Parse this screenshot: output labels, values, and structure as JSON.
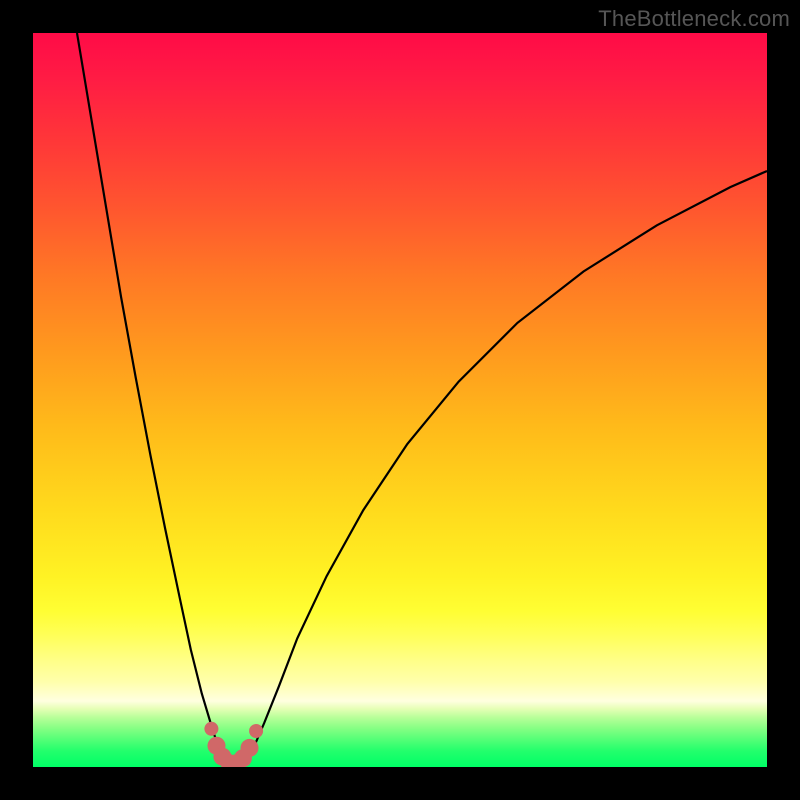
{
  "watermark": "TheBottleneck.com",
  "chart_data": {
    "type": "line",
    "title": "",
    "xlabel": "",
    "ylabel": "",
    "xlim": [
      0,
      100
    ],
    "ylim": [
      0,
      100
    ],
    "curve_left": {
      "name": "left-branch",
      "x": [
        6.0,
        8.0,
        10.0,
        12.0,
        14.0,
        16.0,
        18.0,
        20.0,
        21.5,
        23.0,
        24.5,
        25.5,
        26.5
      ],
      "y": [
        100.0,
        88.0,
        76.0,
        64.0,
        53.0,
        42.5,
        32.5,
        23.0,
        16.0,
        10.0,
        5.0,
        2.0,
        0.4
      ]
    },
    "curve_right": {
      "name": "right-branch",
      "x": [
        29.0,
        30.0,
        31.5,
        33.5,
        36.0,
        40.0,
        45.0,
        51.0,
        58.0,
        66.0,
        75.0,
        85.0,
        95.0,
        100.0
      ],
      "y": [
        0.4,
        2.5,
        6.0,
        11.0,
        17.5,
        26.0,
        35.0,
        44.0,
        52.5,
        60.5,
        67.5,
        73.8,
        79.0,
        81.2
      ]
    },
    "bottom_marks": {
      "name": "bottleneck-points",
      "x": [
        24.3,
        25.0,
        25.8,
        26.8,
        27.7,
        28.6,
        29.5,
        30.4
      ],
      "y": [
        5.2,
        2.9,
        1.4,
        0.5,
        0.5,
        1.2,
        2.6,
        4.9
      ]
    },
    "gradient_stops_pct": {
      "red_top": 0,
      "yellow_mid": 78,
      "pale_yellow": 91,
      "green_bottom": 100
    }
  }
}
